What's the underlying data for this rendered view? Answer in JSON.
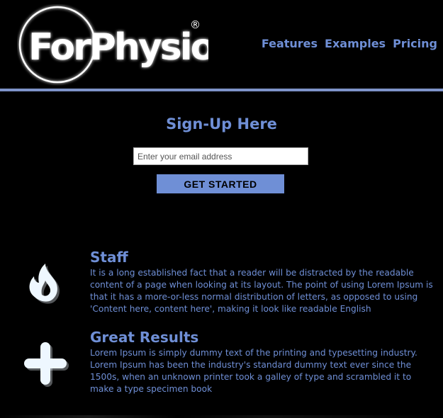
{
  "header": {
    "logo_text": "ForPhysio",
    "logo_mark": "®",
    "nav": [
      {
        "label": "Features"
      },
      {
        "label": "Examples"
      },
      {
        "label": "Pricing"
      }
    ]
  },
  "signup": {
    "title": "Sign-Up Here",
    "email_placeholder": "Enter your email address",
    "button_label": "GET STARTED"
  },
  "features": [
    {
      "title": "Staff",
      "icon": "flame-icon",
      "text": "It is a long established fact that a reader will be distracted by the readable content of a page when looking at its layout. The point of using Lorem Ipsum is that it has a more-or-less normal distribution of letters, as opposed to using 'Content here, content here', making it look like readable English"
    },
    {
      "title": "Great Results",
      "icon": "plus-icon",
      "text": "Lorem Ipsum is simply dummy text of the printing and typesetting industry. Lorem Ipsum has been the industry's standard dummy text ever since the 1500s, when an unknown printer took a galley of type and scrambled it to make a type specimen book"
    }
  ],
  "colors": {
    "background": "#000000",
    "accent": "#6f8fd6",
    "divider": "#7e93c9",
    "icon": "#e8f4ff"
  }
}
